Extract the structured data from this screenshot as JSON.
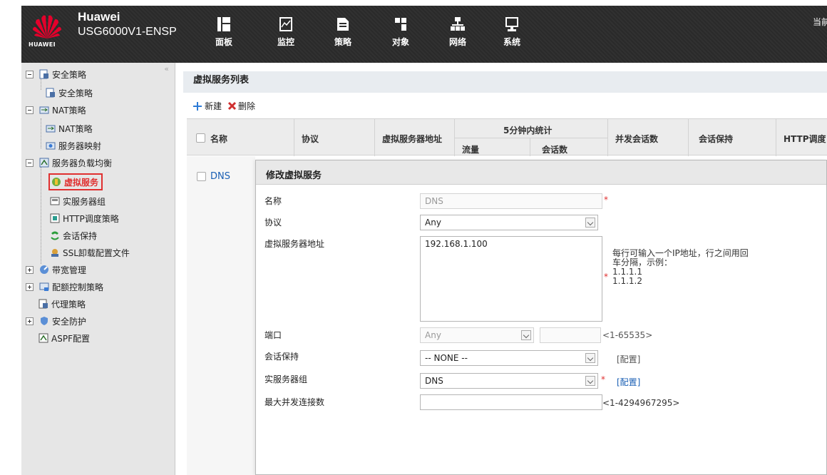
{
  "header": {
    "brand_name": "Huawei",
    "device": "USG6000V1-ENSP",
    "logo_text": "HUAWEI",
    "corner_text": "当前",
    "nav": [
      {
        "label": "面板",
        "icon": "dashboard-icon"
      },
      {
        "label": "监控",
        "icon": "monitor-icon"
      },
      {
        "label": "策略",
        "icon": "policy-icon"
      },
      {
        "label": "对象",
        "icon": "object-icon"
      },
      {
        "label": "网络",
        "icon": "network-icon"
      },
      {
        "label": "系统",
        "icon": "system-icon"
      }
    ]
  },
  "sidebar": {
    "collapse": "«",
    "items": [
      {
        "label": "安全策略"
      },
      {
        "label": "安全策略"
      },
      {
        "label": "NAT策略"
      },
      {
        "label": "NAT策略"
      },
      {
        "label": "服务器映射"
      },
      {
        "label": "服务器负载均衡"
      },
      {
        "label": "虚拟服务"
      },
      {
        "label": "实服务器组"
      },
      {
        "label": "HTTP调度策略"
      },
      {
        "label": "会话保持"
      },
      {
        "label": "SSL卸载配置文件"
      },
      {
        "label": "带宽管理"
      },
      {
        "label": "配额控制策略"
      },
      {
        "label": "代理策略"
      },
      {
        "label": "安全防护"
      },
      {
        "label": "ASPF配置"
      }
    ]
  },
  "main": {
    "title": "虚拟服务列表",
    "toolbar": {
      "new_label": "新建",
      "delete_label": "删除"
    },
    "columns": {
      "name": "名称",
      "protocol": "协议",
      "vs_addr": "虚拟服务器地址",
      "stats_group": "5分钟内统计",
      "traffic": "流量",
      "sessions": "会话数",
      "concurrent": "并发会话数",
      "persistence": "会话保持",
      "http": "HTTP调度"
    },
    "rows": [
      {
        "name": "DNS"
      }
    ]
  },
  "dialog": {
    "title": "修改虚拟服务",
    "fields": {
      "name_label": "名称",
      "name_value": "DNS",
      "protocol_label": "协议",
      "protocol_value": "Any",
      "vs_addr_label": "虚拟服务器地址",
      "vs_addr_value": "192.168.1.100",
      "vs_addr_hint_1": "每行可输入一个IP地址，行之间用回",
      "vs_addr_hint_2": "车分隔，示例：",
      "vs_addr_hint_3": "1.1.1.1",
      "vs_addr_hint_4": "1.1.1.2",
      "port_label": "端口",
      "port_value": "Any",
      "port_hint": "<1-65535>",
      "persist_label": "会话保持",
      "persist_value": "-- NONE --",
      "persist_config": "[配置]",
      "group_label": "实服务器组",
      "group_value": "DNS",
      "group_config": "[配置]",
      "maxconn_label": "最大并发连接数",
      "maxconn_value": "",
      "maxconn_hint": "<1-4294967295>"
    }
  },
  "colors": {
    "accent_red": "#e03030",
    "link_blue": "#1a5fb4",
    "header_bg": "#2b2b2b"
  }
}
